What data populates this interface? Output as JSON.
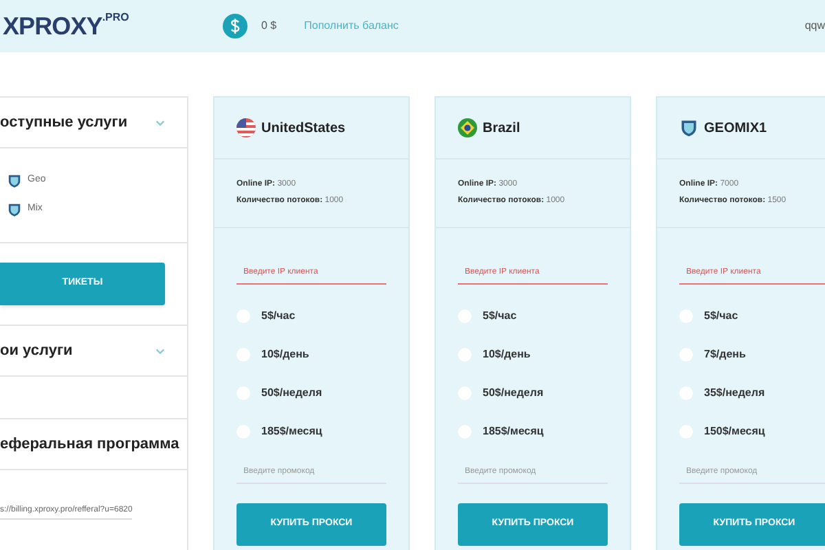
{
  "header": {
    "logo": "XPROXY",
    "logo_suffix": ".PRO",
    "balance": "0 $",
    "top_up": "Пополнить баланс",
    "user": "qqw"
  },
  "sidebar": {
    "sections": [
      {
        "title": "оступные услуги",
        "items": [
          "Geo",
          "Mix"
        ]
      },
      {
        "title": "ои услуги"
      },
      {
        "title": "еферальная программа",
        "link": "s://billing.xproxy.pro/refferal?u=6820"
      }
    ],
    "tickets_button": "ТИКЕТЫ"
  },
  "cards": [
    {
      "name": "UnitedStates",
      "kind": "us",
      "online_label": "Online IP:",
      "online": "3000",
      "threads_label": "Количество потоков:",
      "threads": "1000",
      "ip_placeholder": "Введите IP клиента",
      "ip_error": true,
      "plans": [
        {
          "label": "5$/час",
          "selected": false
        },
        {
          "label": "10$/день",
          "selected": false
        },
        {
          "label": "50$/неделя",
          "selected": false
        },
        {
          "label": "185$/месяц",
          "selected": false
        }
      ],
      "promo_placeholder": "Введите промокод",
      "buy": "КУПИТЬ ПРОКСИ"
    },
    {
      "name": "Brazil",
      "kind": "br",
      "online_label": "Online IP:",
      "online": "3000",
      "threads_label": "Количество потоков:",
      "threads": "1000",
      "ip_placeholder": "Введите IP клиента",
      "ip_error": true,
      "plans": [
        {
          "label": "5$/час",
          "selected": false
        },
        {
          "label": "10$/день",
          "selected": false
        },
        {
          "label": "50$/неделя",
          "selected": false
        },
        {
          "label": "185$/месяц",
          "selected": false
        }
      ],
      "promo_placeholder": "Введите промокод",
      "buy": "КУПИТЬ ПРОКСИ"
    },
    {
      "name": "GEOMIX1",
      "kind": "shield",
      "online_label": "Online IP:",
      "online": "7000",
      "threads_label": "Количество потоков:",
      "threads": "1500",
      "ip_placeholder": "Введите IP клиента",
      "ip_error": true,
      "plans": [
        {
          "label": "5$/час",
          "selected": false
        },
        {
          "label": "7$/день",
          "selected": false
        },
        {
          "label": "35$/неделя",
          "selected": false
        },
        {
          "label": "150$/месяц",
          "selected": false
        }
      ],
      "promo_placeholder": "Введите промокод",
      "buy": "КУПИТЬ ПРОКСИ"
    }
  ]
}
